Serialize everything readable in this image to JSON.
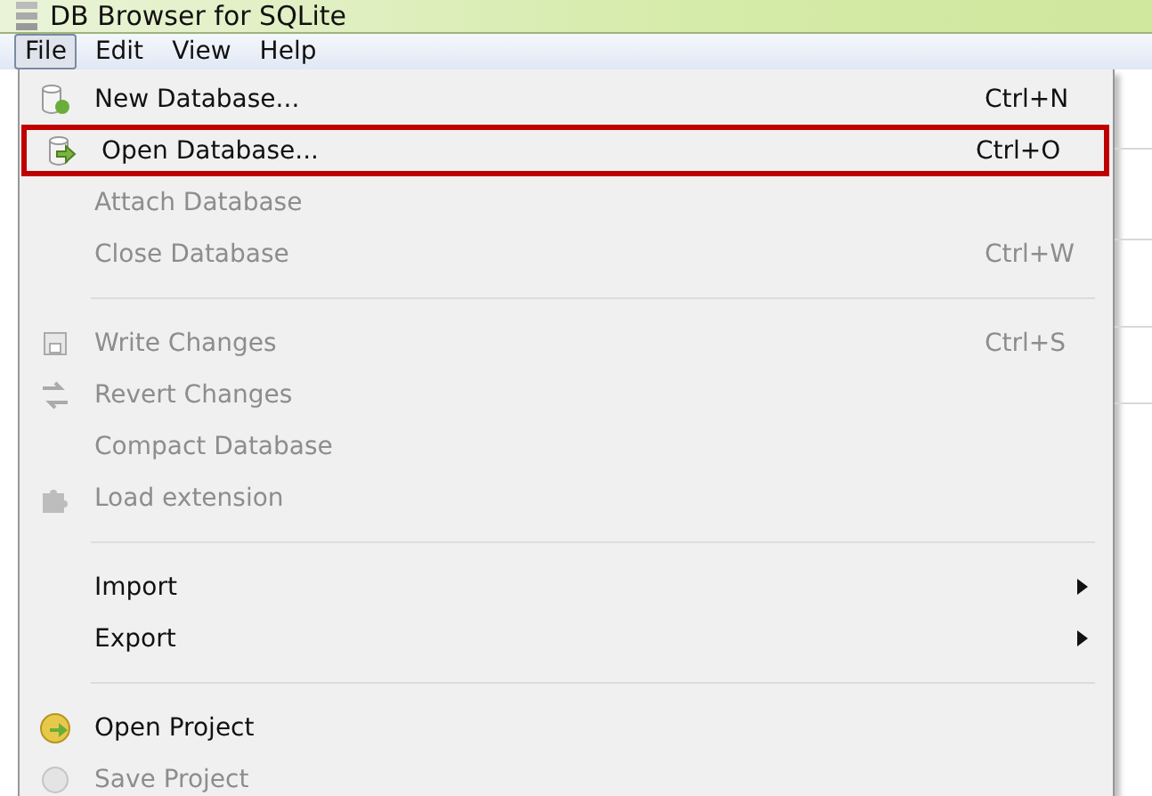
{
  "window": {
    "title": "DB Browser for SQLite"
  },
  "menubar": [
    {
      "label": "File",
      "selected": true
    },
    {
      "label": "Edit",
      "selected": false
    },
    {
      "label": "View",
      "selected": false
    },
    {
      "label": "Help",
      "selected": false
    }
  ],
  "file_menu": [
    {
      "kind": "item",
      "label": "New Database...",
      "shortcut": "Ctrl+N",
      "disabled": false,
      "highlighted": false
    },
    {
      "kind": "item",
      "label": "Open Database...",
      "shortcut": "Ctrl+O",
      "disabled": false,
      "highlighted": true
    },
    {
      "kind": "item",
      "label": "Attach Database",
      "disabled": true,
      "highlighted": false
    },
    {
      "kind": "item",
      "label": "Close Database",
      "shortcut": "Ctrl+W",
      "disabled": true,
      "highlighted": false
    },
    {
      "kind": "separator"
    },
    {
      "kind": "item",
      "label": "Write Changes",
      "shortcut": "Ctrl+S",
      "disabled": true,
      "highlighted": false
    },
    {
      "kind": "item",
      "label": "Revert Changes",
      "disabled": true,
      "highlighted": false
    },
    {
      "kind": "item",
      "label": "Compact Database",
      "disabled": true,
      "highlighted": false
    },
    {
      "kind": "item",
      "label": "Load extension",
      "disabled": true,
      "highlighted": false
    },
    {
      "kind": "separator"
    },
    {
      "kind": "submenu",
      "label": "Import",
      "disabled": false,
      "highlighted": false
    },
    {
      "kind": "submenu",
      "label": "Export",
      "disabled": false,
      "highlighted": false
    },
    {
      "kind": "separator"
    },
    {
      "kind": "item",
      "label": "Open Project",
      "disabled": false,
      "highlighted": false
    },
    {
      "kind": "item",
      "label": "Save Project",
      "disabled": true,
      "highlighted": false
    }
  ]
}
